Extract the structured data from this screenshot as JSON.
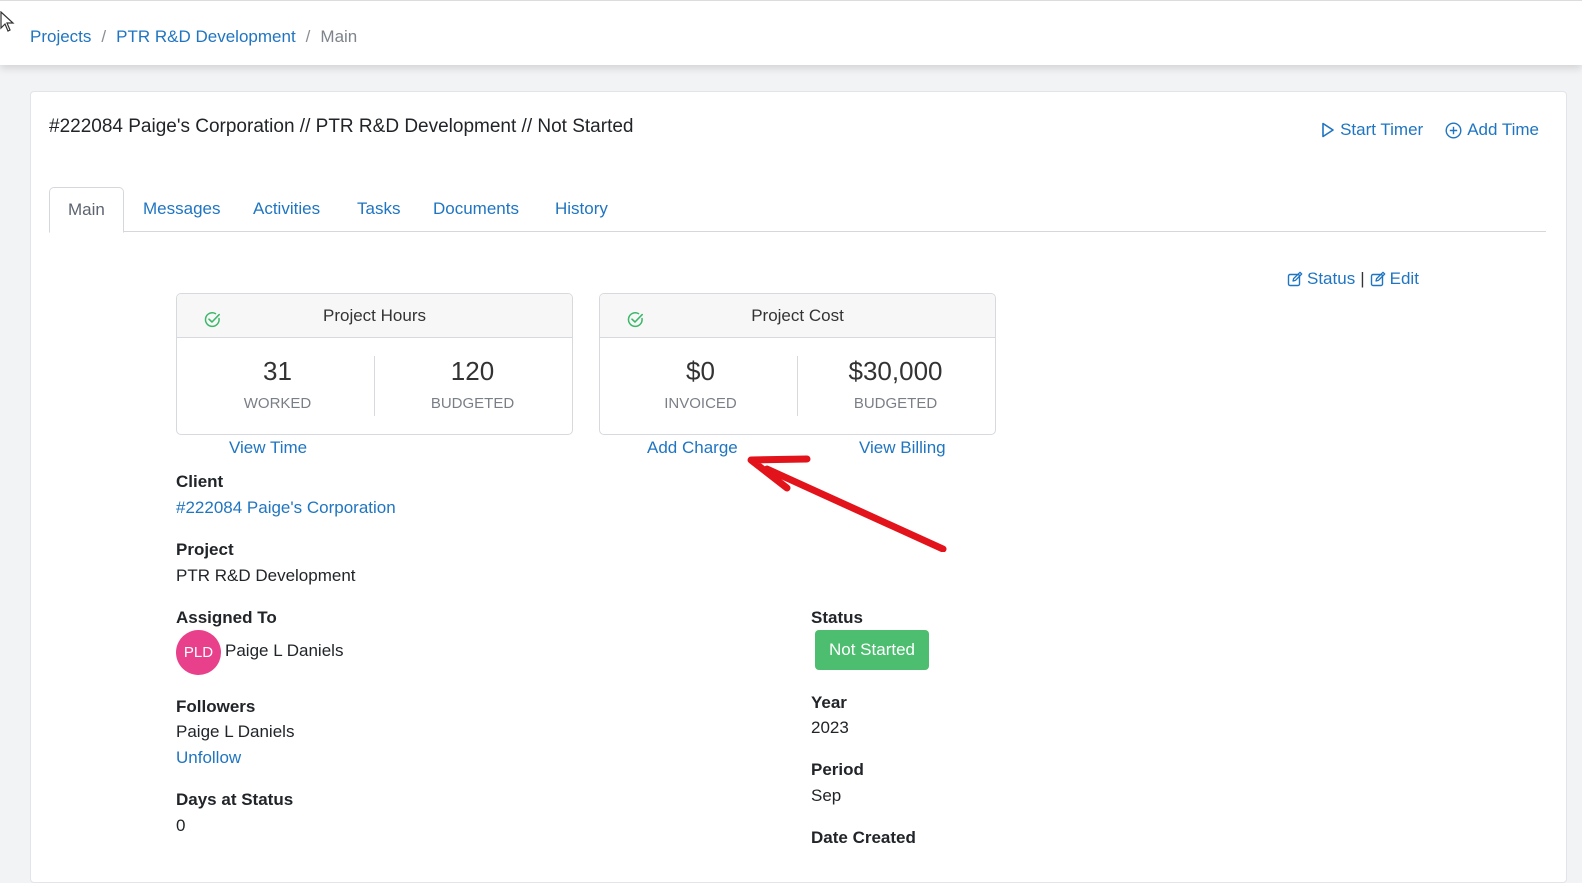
{
  "breadcrumb": {
    "projects": "Projects",
    "project": "PTR R&D Development",
    "current": "Main",
    "separator": "/"
  },
  "header": {
    "title": "#222084 Paige's Corporation // PTR R&D Development // Not Started"
  },
  "actions": {
    "start_timer": "Start Timer",
    "add_time": "Add Time"
  },
  "tabs": {
    "main": "Main",
    "messages": "Messages",
    "activities": "Activities",
    "tasks": "Tasks",
    "documents": "Documents",
    "history": "History"
  },
  "top_links": {
    "status": "Status",
    "separator": "|",
    "edit": "Edit"
  },
  "hours_card": {
    "title": "Project Hours",
    "worked_value": "31",
    "worked_label": "WORKED",
    "budgeted_value": "120",
    "budgeted_label": "BUDGETED",
    "link": "View Time"
  },
  "cost_card": {
    "title": "Project Cost",
    "invoiced_value": "$0",
    "invoiced_label": "INVOICED",
    "budgeted_value": "$30,000",
    "budgeted_label": "BUDGETED",
    "add_charge": "Add Charge",
    "view_billing": "View Billing"
  },
  "fields": {
    "client_label": "Client",
    "client_value": "#222084 Paige's Corporation",
    "project_label": "Project",
    "project_value": "PTR R&D Development",
    "assigned_label": "Assigned To",
    "assigned_initials": "PLD",
    "assigned_name": "Paige L Daniels",
    "followers_label": "Followers",
    "followers_value": "Paige L Daniels",
    "unfollow": "Unfollow",
    "days_label": "Days at Status",
    "days_value": "0",
    "status_label": "Status",
    "status_value": "Not Started",
    "year_label": "Year",
    "year_value": "2023",
    "period_label": "Period",
    "period_value": "Sep",
    "date_created_label": "Date Created"
  },
  "colors": {
    "link": "#1f75c1",
    "success": "#4dbd6f",
    "avatar": "#e8408a",
    "annotation_arrow": "#e3131b"
  }
}
